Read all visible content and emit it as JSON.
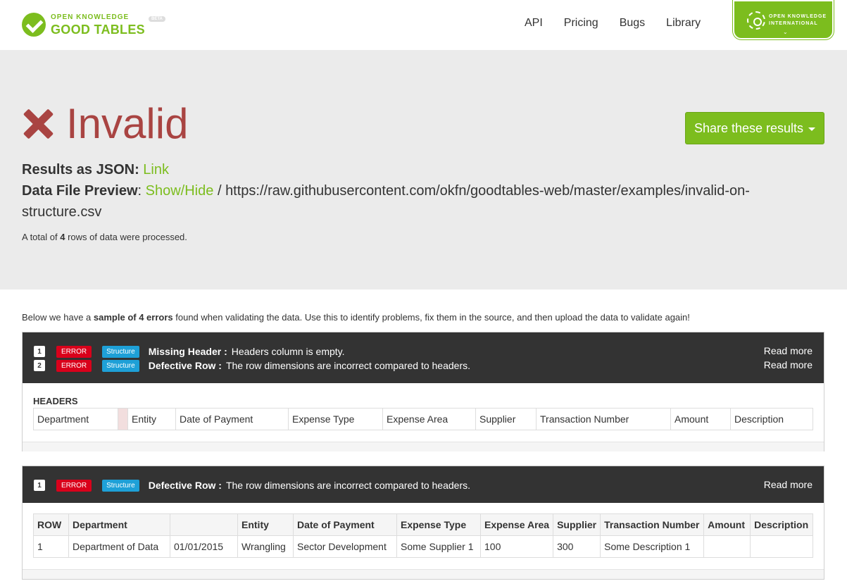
{
  "brand": {
    "small": "OPEN KNOWLEDGE",
    "big": "GOOD TABLES",
    "badge": "BETA"
  },
  "nav": [
    "API",
    "Pricing",
    "Bugs",
    "Library"
  ],
  "oki": {
    "line1": "OPEN KNOWLEDGE",
    "line2": "INTERNATIONAL"
  },
  "status": {
    "label": "Invalid"
  },
  "share_button": "Share these results",
  "results": {
    "json_label": "Results as JSON:",
    "json_link": "Link",
    "preview_label": "Data File Preview",
    "preview_link": "Show/Hide",
    "separator": "/",
    "file_url": "https://raw.githubusercontent.com/okfn/goodtables-web/master/examples/invalid-on-structure.csv"
  },
  "processed": {
    "prefix": "A total of",
    "count": "4",
    "suffix": "rows of data were processed."
  },
  "intro": {
    "prefix": "Below we have a",
    "bold": "sample of 4 errors",
    "suffix": "found when validating the data. Use this to identify problems, fix them in the source, and then upload the data to validate again!"
  },
  "panel1": {
    "errors": [
      {
        "num": "1",
        "level": "ERROR",
        "type": "Structure",
        "title": "Missing Header :",
        "desc": "Headers column is empty.",
        "more": "Read more"
      },
      {
        "num": "2",
        "level": "ERROR",
        "type": "Structure",
        "title": "Defective Row :",
        "desc": "The row dimensions are incorrect compared to headers.",
        "more": "Read more"
      }
    ],
    "headers_title": "HEADERS",
    "headers": [
      "Department",
      "",
      "Entity",
      "Date of Payment",
      "Expense Type",
      "Expense Area",
      "Supplier",
      "Transaction Number",
      "Amount",
      "Description"
    ]
  },
  "panel2": {
    "errors": [
      {
        "num": "1",
        "level": "ERROR",
        "type": "Structure",
        "title": "Defective Row :",
        "desc": "The row dimensions are incorrect compared to headers.",
        "more": "Read more"
      }
    ],
    "columns": [
      "ROW",
      "Department",
      "",
      "Entity",
      "Date of Payment",
      "Expense Type",
      "Expense Area",
      "Supplier",
      "Transaction Number",
      "Amount",
      "Description"
    ],
    "rows": [
      [
        "1",
        "Department of Data",
        "01/01/2015",
        "Wrangling",
        "Sector Development",
        "Some Supplier 1",
        "100",
        "300",
        "Some Description 1",
        "",
        ""
      ]
    ]
  },
  "colors": {
    "brand_green": "#7cbd1e",
    "invalid_red": "#a94442",
    "error_red": "#d9001b",
    "structure_blue": "#1ea0d7",
    "panel_dark": "#333333"
  }
}
